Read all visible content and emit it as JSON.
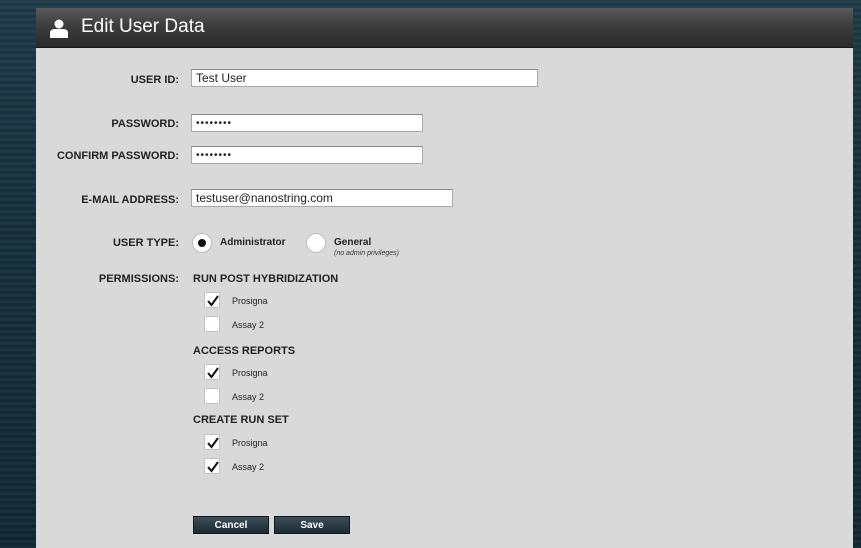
{
  "dialog": {
    "title": "Edit User Data",
    "icon": "user-icon"
  },
  "form": {
    "user_id_label": "USER ID:",
    "user_id_value": "Test User",
    "password_label": "PASSWORD:",
    "password_value": "••••••••",
    "confirm_password_label": "CONFIRM PASSWORD:",
    "confirm_password_value": "••••••••",
    "email_label": "E-MAIL ADDRESS:",
    "email_value": "testuser@nanostring.com",
    "user_type_label": "USER TYPE:",
    "user_type_options": [
      {
        "label": "Administrator",
        "selected": true
      },
      {
        "label": "General",
        "note": "(no admin privileges)",
        "selected": false
      }
    ],
    "permissions_label": "PERMISSIONS:"
  },
  "permissions": [
    {
      "title": "RUN POST HYBRIDIZATION",
      "items": [
        {
          "label": "Prosigna",
          "checked": true
        },
        {
          "label": "Assay 2",
          "checked": false
        }
      ]
    },
    {
      "title": "ACCESS REPORTS",
      "items": [
        {
          "label": "Prosigna",
          "checked": true
        },
        {
          "label": "Assay 2",
          "checked": false
        }
      ]
    },
    {
      "title": "CREATE RUN SET",
      "items": [
        {
          "label": "Prosigna",
          "checked": true
        },
        {
          "label": "Assay 2",
          "checked": true
        }
      ]
    }
  ],
  "buttons": {
    "cancel": "Cancel",
    "save": "Save"
  }
}
